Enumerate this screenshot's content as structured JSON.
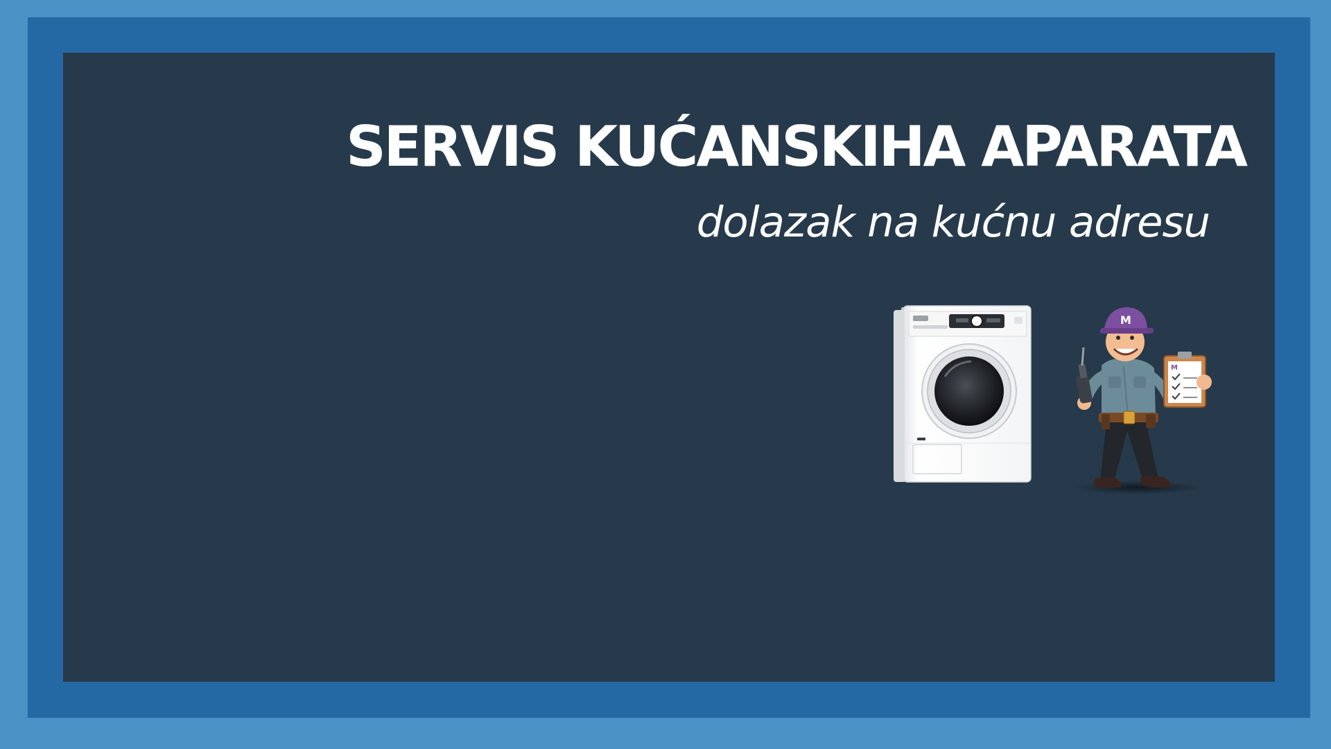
{
  "banner": {
    "title": "SERVIS KUĆANSKIHA APARATA",
    "subtitle": "dolazak na kućnu adresu",
    "colors": {
      "outer_border": "#4a92c6",
      "inner_border": "#2468a4",
      "panel": "#263a4b",
      "text": "#ffffff"
    }
  },
  "illustration": {
    "appliance_icon": "washing-machine-icon",
    "technician_icon": "repairman-icon",
    "cap_logo": "M"
  }
}
